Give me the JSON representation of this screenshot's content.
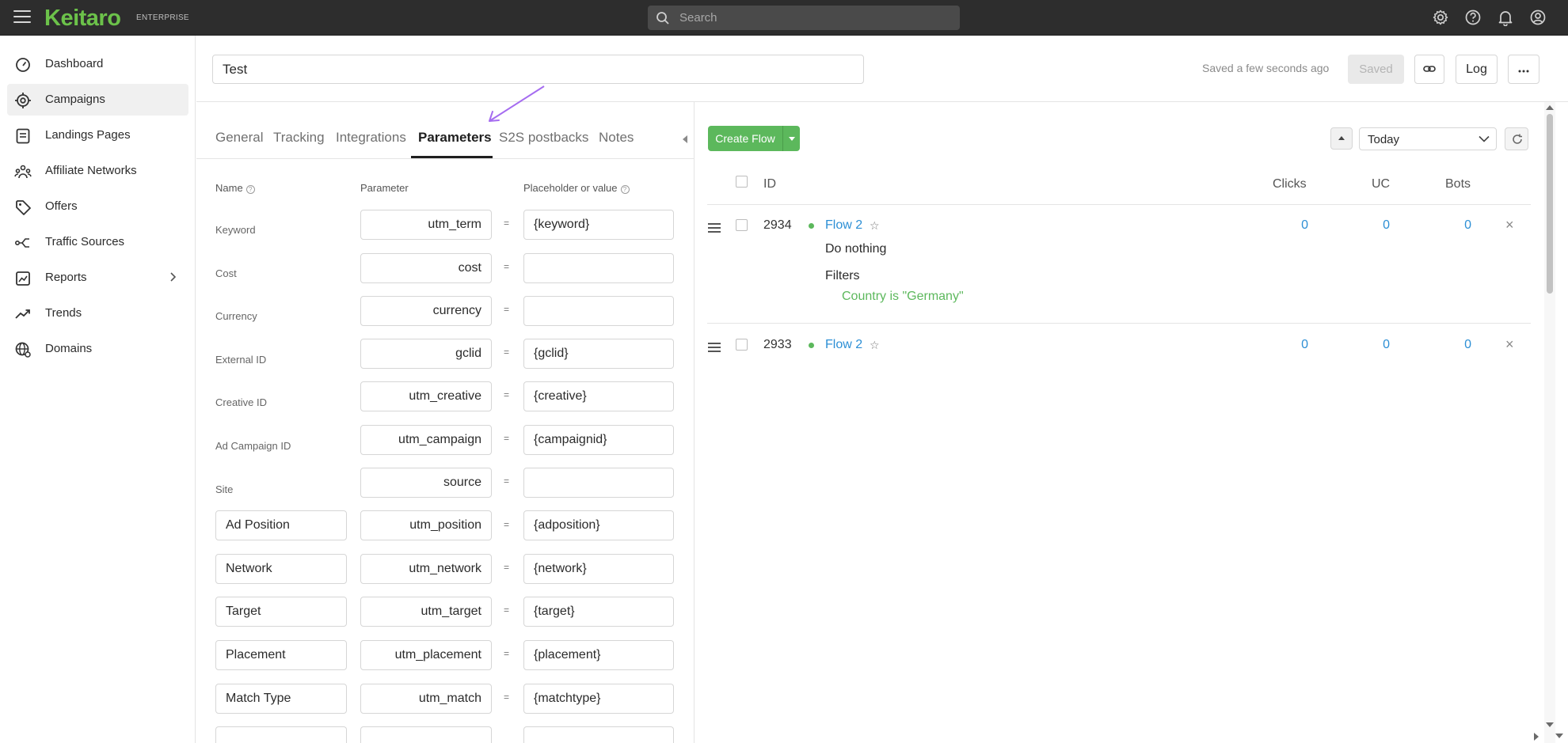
{
  "app": {
    "logo": "Keitaro",
    "edition": "ENTERPRISE",
    "search_placeholder": "Search"
  },
  "sidebar": {
    "items": [
      {
        "label": "Dashboard",
        "icon": "gauge-icon"
      },
      {
        "label": "Campaigns",
        "icon": "target-icon",
        "active": true
      },
      {
        "label": "Landings Pages",
        "icon": "document-icon"
      },
      {
        "label": "Affiliate Networks",
        "icon": "users-network-icon"
      },
      {
        "label": "Offers",
        "icon": "tag-icon"
      },
      {
        "label": "Traffic Sources",
        "icon": "traffic-route-icon"
      },
      {
        "label": "Reports",
        "icon": "report-chart-icon",
        "has_submenu": true
      },
      {
        "label": "Trends",
        "icon": "trend-line-icon"
      },
      {
        "label": "Domains",
        "icon": "globe-settings-icon"
      }
    ]
  },
  "header": {
    "campaign_name": "Test",
    "status_text": "Saved a few seconds ago",
    "saved_label": "Saved",
    "log_label": "Log"
  },
  "tabs": [
    {
      "label": "General"
    },
    {
      "label": "Tracking"
    },
    {
      "label": "Integrations"
    },
    {
      "label": "Parameters",
      "active": true
    },
    {
      "label": "S2S postbacks"
    },
    {
      "label": "Notes"
    }
  ],
  "params": {
    "headers": {
      "name": "Name",
      "parameter": "Parameter",
      "value": "Placeholder or value"
    },
    "rows": [
      {
        "name": "Keyword",
        "editable_name": false,
        "parameter": "utm_term",
        "value": "{keyword}"
      },
      {
        "name": "Cost",
        "editable_name": false,
        "parameter": "cost",
        "value": ""
      },
      {
        "name": "Currency",
        "editable_name": false,
        "parameter": "currency",
        "value": ""
      },
      {
        "name": "External ID",
        "editable_name": false,
        "parameter": "gclid",
        "value": "{gclid}"
      },
      {
        "name": "Creative ID",
        "editable_name": false,
        "parameter": "utm_creative",
        "value": "{creative}"
      },
      {
        "name": "Ad Campaign ID",
        "editable_name": false,
        "parameter": "utm_campaign",
        "value": "{campaignid}"
      },
      {
        "name": "Site",
        "editable_name": false,
        "parameter": "source",
        "value": ""
      },
      {
        "name": "Ad Position",
        "editable_name": true,
        "parameter": "utm_position",
        "value": "{adposition}"
      },
      {
        "name": "Network",
        "editable_name": true,
        "parameter": "utm_network",
        "value": "{network}"
      },
      {
        "name": "Target",
        "editable_name": true,
        "parameter": "utm_target",
        "value": "{target}"
      },
      {
        "name": "Placement",
        "editable_name": true,
        "parameter": "utm_placement",
        "value": "{placement}"
      },
      {
        "name": "Match Type",
        "editable_name": true,
        "parameter": "utm_match",
        "value": "{matchtype}"
      }
    ],
    "equals": "="
  },
  "flows_panel": {
    "create_label": "Create Flow",
    "date_range": "Today",
    "columns": {
      "id": "ID",
      "clicks": "Clicks",
      "uc": "UC",
      "bots": "Bots"
    },
    "flows": [
      {
        "id": "2934",
        "name": "Flow 2",
        "action": "Do nothing",
        "filters_label": "Filters",
        "filter": "Country is \"Germany\"",
        "clicks": "0",
        "uc": "0",
        "bots": "0",
        "status_color": "#5cb85c"
      },
      {
        "id": "2933",
        "name": "Flow 2",
        "clicks": "0",
        "uc": "0",
        "bots": "0",
        "status_color": "#5cb85c"
      }
    ]
  },
  "colors": {
    "brand_green": "#6cc24a",
    "topbar": "#2d2d2d",
    "link_blue": "#2d8fd5",
    "button_green": "#5cb85c",
    "annotation_arrow": "#a56cf0"
  }
}
